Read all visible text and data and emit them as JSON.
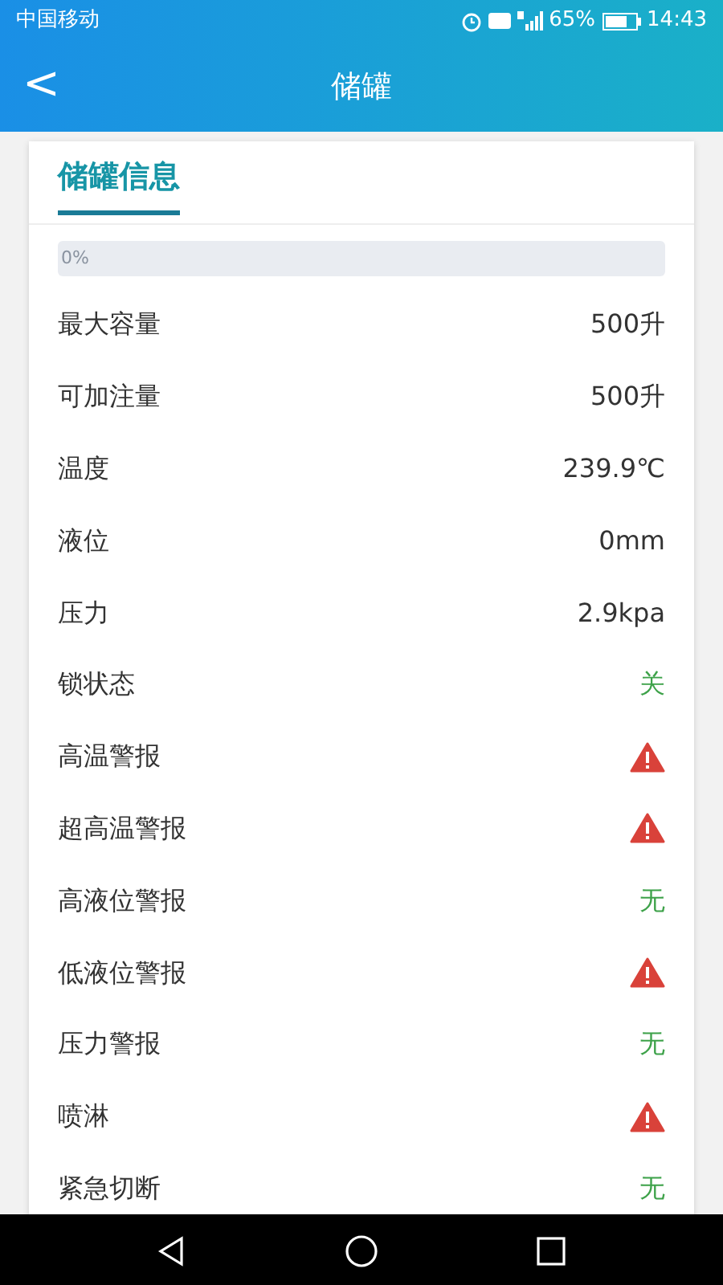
{
  "status_bar": {
    "carrier": "中国移动",
    "battery_text": "65%",
    "time": "14:43"
  },
  "header": {
    "back": "<",
    "title": "储罐"
  },
  "card": {
    "title": "储罐信息",
    "progress": {
      "level": 0,
      "label": "0%"
    },
    "rows": [
      {
        "label": "最大容量",
        "kind": "text",
        "value": "500升"
      },
      {
        "label": "可加注量",
        "kind": "text",
        "value": "500升"
      },
      {
        "label": "温度",
        "kind": "text",
        "value": "239.9℃"
      },
      {
        "label": "液位",
        "kind": "text",
        "value": "0mm"
      },
      {
        "label": "压力",
        "kind": "text",
        "value": "2.9kpa"
      },
      {
        "label": "锁状态",
        "kind": "status",
        "value": "关"
      },
      {
        "label": "高温警报",
        "kind": "alarm"
      },
      {
        "label": "超高温警报",
        "kind": "alarm"
      },
      {
        "label": "高液位警报",
        "kind": "status",
        "value": "无"
      },
      {
        "label": "低液位警报",
        "kind": "alarm"
      },
      {
        "label": "压力警报",
        "kind": "status",
        "value": "无"
      },
      {
        "label": "喷淋",
        "kind": "alarm"
      },
      {
        "label": "紧急切断",
        "kind": "status",
        "value": "无"
      }
    ]
  }
}
